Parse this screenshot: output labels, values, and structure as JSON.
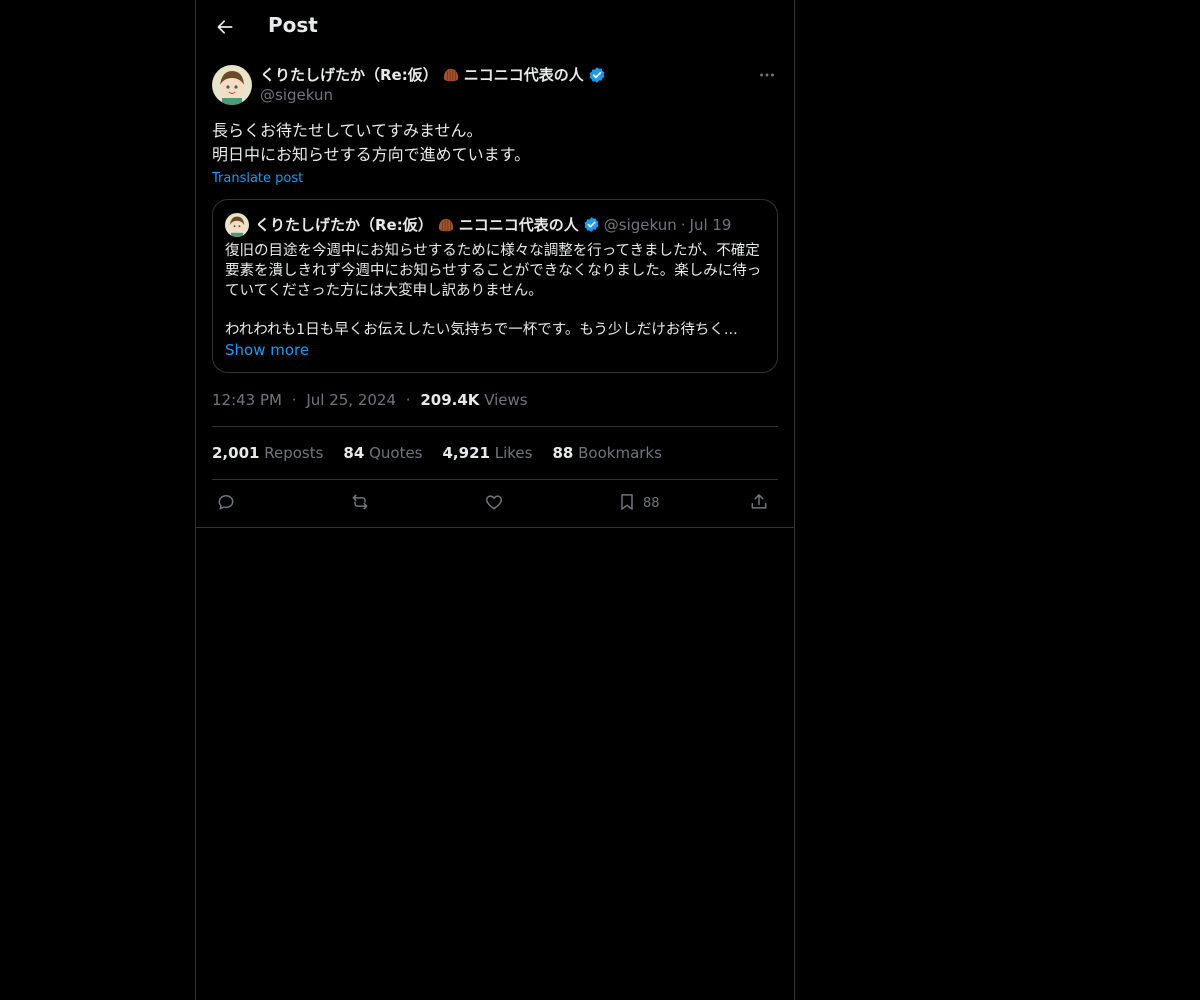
{
  "header": {
    "title": "Post",
    "back_icon": "arrow-left-icon"
  },
  "author": {
    "name": "くりたしげたか（Re:仮）",
    "name_suffix": "ニコニコ代表の人",
    "handle": "@sigekun",
    "verified": true,
    "verified_color": "#1d9bf0"
  },
  "post": {
    "lines": [
      "長らくお待たせしていてすみません。",
      "明日中にお知らせする方向で進めています。"
    ],
    "translate_label": "Translate post"
  },
  "quote": {
    "name": "くりたしげたか（Re:仮）",
    "name_suffix": "ニコニコ代表の人",
    "handle": "@sigekun",
    "separator": "·",
    "date": "Jul 19",
    "paragraph1": "復旧の目途を今週中にお知らせするために様々な調整を行ってきましたが、不確定要素を潰しきれず今週中にお知らせすることができなくなりました。楽しみに待っていてくださった方には大変申し訳ありません。",
    "paragraph2": "われわれも1日も早くお伝えしたい気持ちで一杯です。もう少しだけお待ちく...",
    "show_more": "Show more"
  },
  "meta": {
    "time": "12:43 PM",
    "dot": "·",
    "date": "Jul 25, 2024",
    "views_count": "209.4K",
    "views_label": "Views"
  },
  "stats": [
    {
      "num": "2,001",
      "label": "Reposts"
    },
    {
      "num": "84",
      "label": "Quotes"
    },
    {
      "num": "4,921",
      "label": "Likes"
    },
    {
      "num": "88",
      "label": "Bookmarks"
    }
  ],
  "actions": {
    "bookmark_count": "88"
  },
  "colors": {
    "background": "#000000",
    "border": "#2f3336",
    "text": "#e7e9ea",
    "muted": "#71767b",
    "link": "#1d9bf0"
  }
}
